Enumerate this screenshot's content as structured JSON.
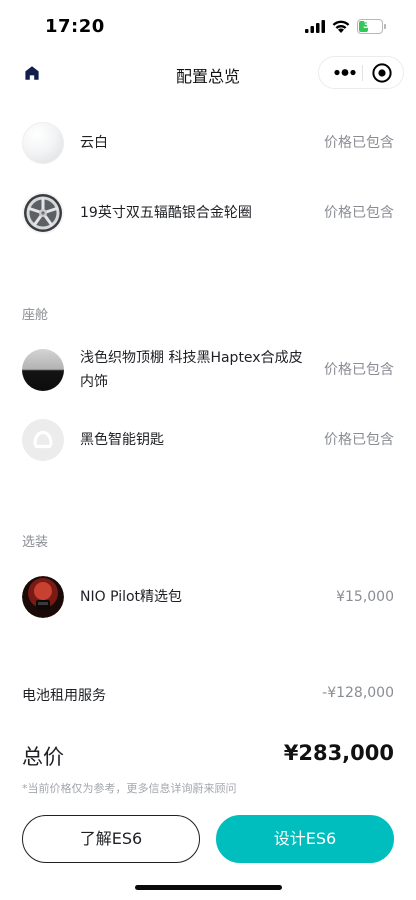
{
  "status_bar": {
    "time": "17:20",
    "battery_level": "37",
    "battery_fraction": 0.37,
    "battery_color": "#33c759"
  },
  "nav": {
    "title": "配置总览",
    "home_icon": "home-icon",
    "more_icon": "more-dots-icon",
    "target_icon": "target-icon"
  },
  "exterior": {
    "items": [
      {
        "label": "云白",
        "price": "价格已包含",
        "thumb": "white-paint-swatch"
      },
      {
        "label": "19英寸双五辐酷银合金轮圈",
        "price": "价格已包含",
        "thumb": "wheel-rim-thumb"
      }
    ]
  },
  "cabin": {
    "title": "座舱",
    "items": [
      {
        "label_line1": "浅色织物顶棚 科技黑Haptex合成皮",
        "label_line2": "内饰",
        "price": "价格已包含",
        "thumb": "interior-swatch"
      },
      {
        "label": "黑色智能钥匙",
        "price": "价格已包含",
        "thumb": "smart-key-thumb"
      }
    ]
  },
  "options": {
    "title": "选装",
    "items": [
      {
        "label": "NIO Pilot精选包",
        "price": "¥15,000",
        "thumb": "nio-pilot-thumb"
      }
    ]
  },
  "battery_service": {
    "label": "电池租用服务",
    "price": "-¥128,000"
  },
  "total": {
    "label": "总价",
    "value": "¥283,000"
  },
  "disclaimer": "*当前价格仅为参考，更多信息详询蔚来顾问",
  "buttons": {
    "learn": "了解ES6",
    "design": "设计ES6",
    "accent_color": "#00bebe"
  }
}
